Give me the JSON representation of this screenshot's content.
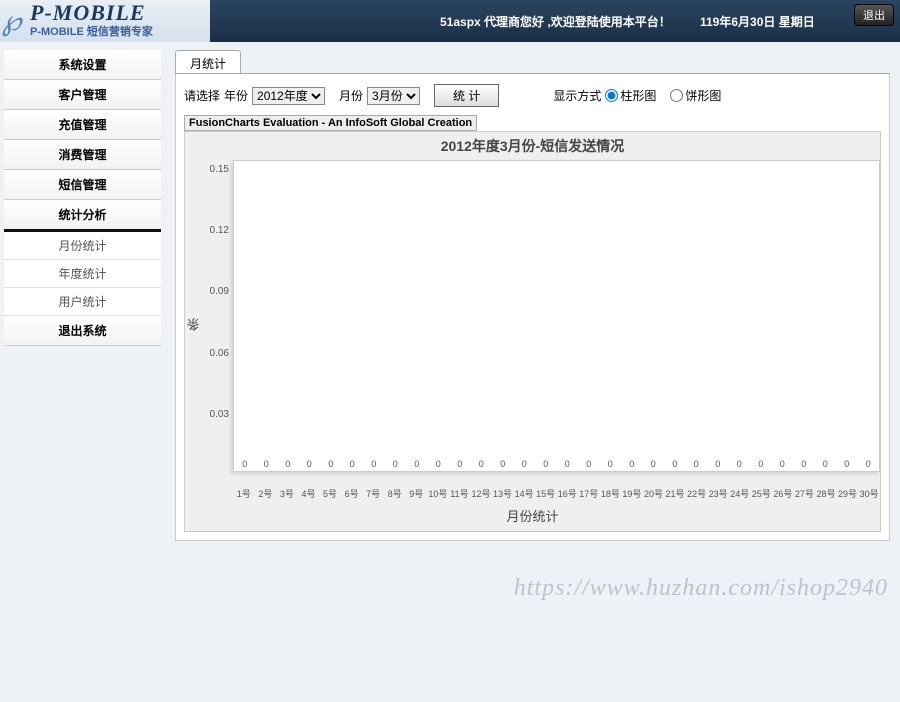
{
  "header": {
    "logo_main": "P-MOBILE",
    "logo_sub": "P-MOBILE 短信营销专家",
    "welcome": "51aspx 代理商您好 ,欢迎登陆使用本平台！",
    "date": "119年6月30日 星期日",
    "logout": "退出"
  },
  "sidebar": {
    "items": [
      {
        "label": "系统设置"
      },
      {
        "label": "客户管理"
      },
      {
        "label": "充值管理"
      },
      {
        "label": "消费管理"
      },
      {
        "label": "短信管理"
      },
      {
        "label": "统计分析",
        "active": true
      }
    ],
    "subitems": [
      {
        "label": "月份统计"
      },
      {
        "label": "年度统计"
      },
      {
        "label": "用户统计"
      }
    ],
    "exit": {
      "label": "退出系统"
    }
  },
  "tabs": {
    "active": "月统计"
  },
  "filter": {
    "prompt": "请选择",
    "year_label": "年份",
    "year_value": "2012年度",
    "month_label": "月份",
    "month_value": "3月份",
    "stat_btn": "统 计",
    "display_label": "显示方式",
    "opt_bar": "柱形图",
    "opt_pie": "饼形图"
  },
  "chart_eval": "FusionCharts Evaluation - An InfoSoft Global Creation",
  "chart_data": {
    "type": "bar",
    "title": "2012年度3月份-短信发送情况",
    "ylabel": "条",
    "xlabel": "月份统计",
    "ylim": [
      0,
      0.15
    ],
    "yticks": [
      "0.15",
      "0.12",
      "0.09",
      "0.06",
      "0.03",
      ""
    ],
    "categories": [
      "1号",
      "2号",
      "3号",
      "4号",
      "5号",
      "6号",
      "7号",
      "8号",
      "9号",
      "10号",
      "11号",
      "12号",
      "13号",
      "14号",
      "15号",
      "16号",
      "17号",
      "18号",
      "19号",
      "20号",
      "21号",
      "22号",
      "23号",
      "24号",
      "25号",
      "26号",
      "27号",
      "28号",
      "29号",
      "30号"
    ],
    "values": [
      0,
      0,
      0,
      0,
      0,
      0,
      0,
      0,
      0,
      0,
      0,
      0,
      0,
      0,
      0,
      0,
      0,
      0,
      0,
      0,
      0,
      0,
      0,
      0,
      0,
      0,
      0,
      0,
      0,
      0
    ]
  },
  "watermark": "https://www.huzhan.com/ishop2940"
}
